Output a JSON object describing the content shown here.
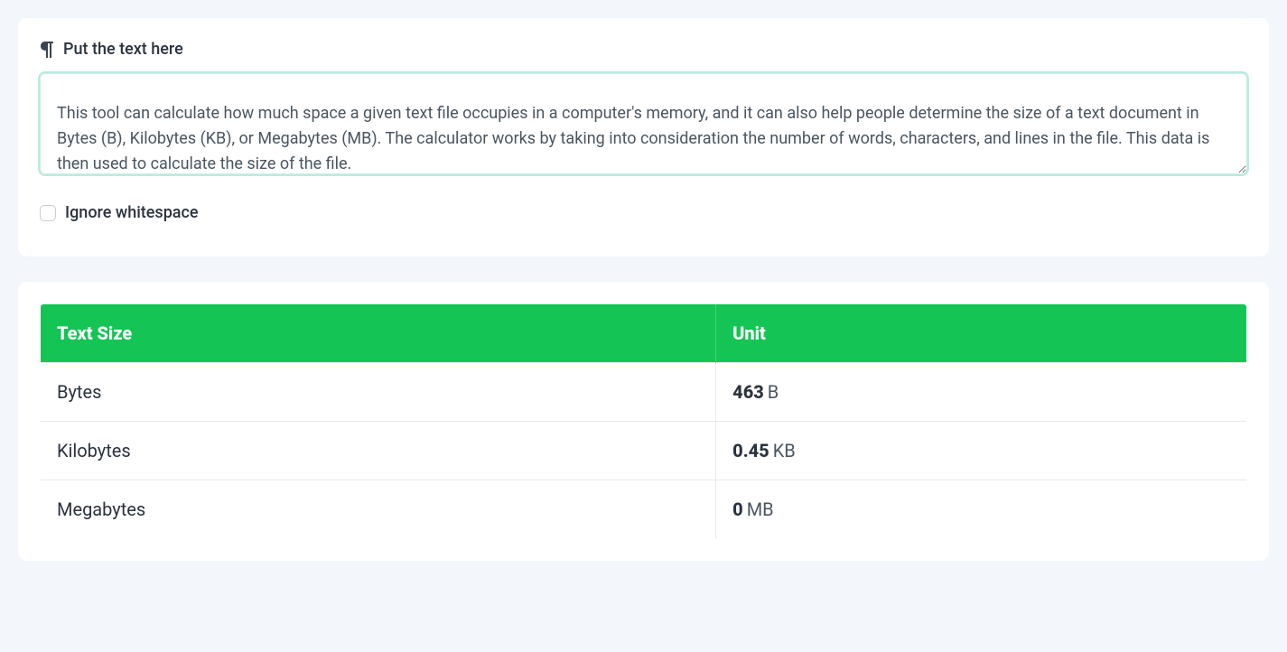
{
  "input": {
    "label": "Put the text here",
    "value": "This tool can calculate how much space a given text file occupies in a computer's memory, and it can also help people determine the size of a text document in Bytes (B), Kilobytes (KB), or Megabytes (MB). The calculator works by taking into consideration the number of words, characters, and lines in the file. This data is then used to calculate the size of the file.",
    "ignore_whitespace_label": "Ignore whitespace",
    "ignore_whitespace_checked": false
  },
  "table": {
    "headers": {
      "col1": "Text Size",
      "col2": "Unit"
    },
    "rows": [
      {
        "label": "Bytes",
        "value": "463",
        "suffix": "B"
      },
      {
        "label": "Kilobytes",
        "value": "0.45",
        "suffix": "KB"
      },
      {
        "label": "Megabytes",
        "value": "0",
        "suffix": "MB"
      }
    ]
  },
  "colors": {
    "accent_green": "#14c454",
    "textarea_focus": "#b9ebdf",
    "page_bg": "#f3f6fa"
  }
}
